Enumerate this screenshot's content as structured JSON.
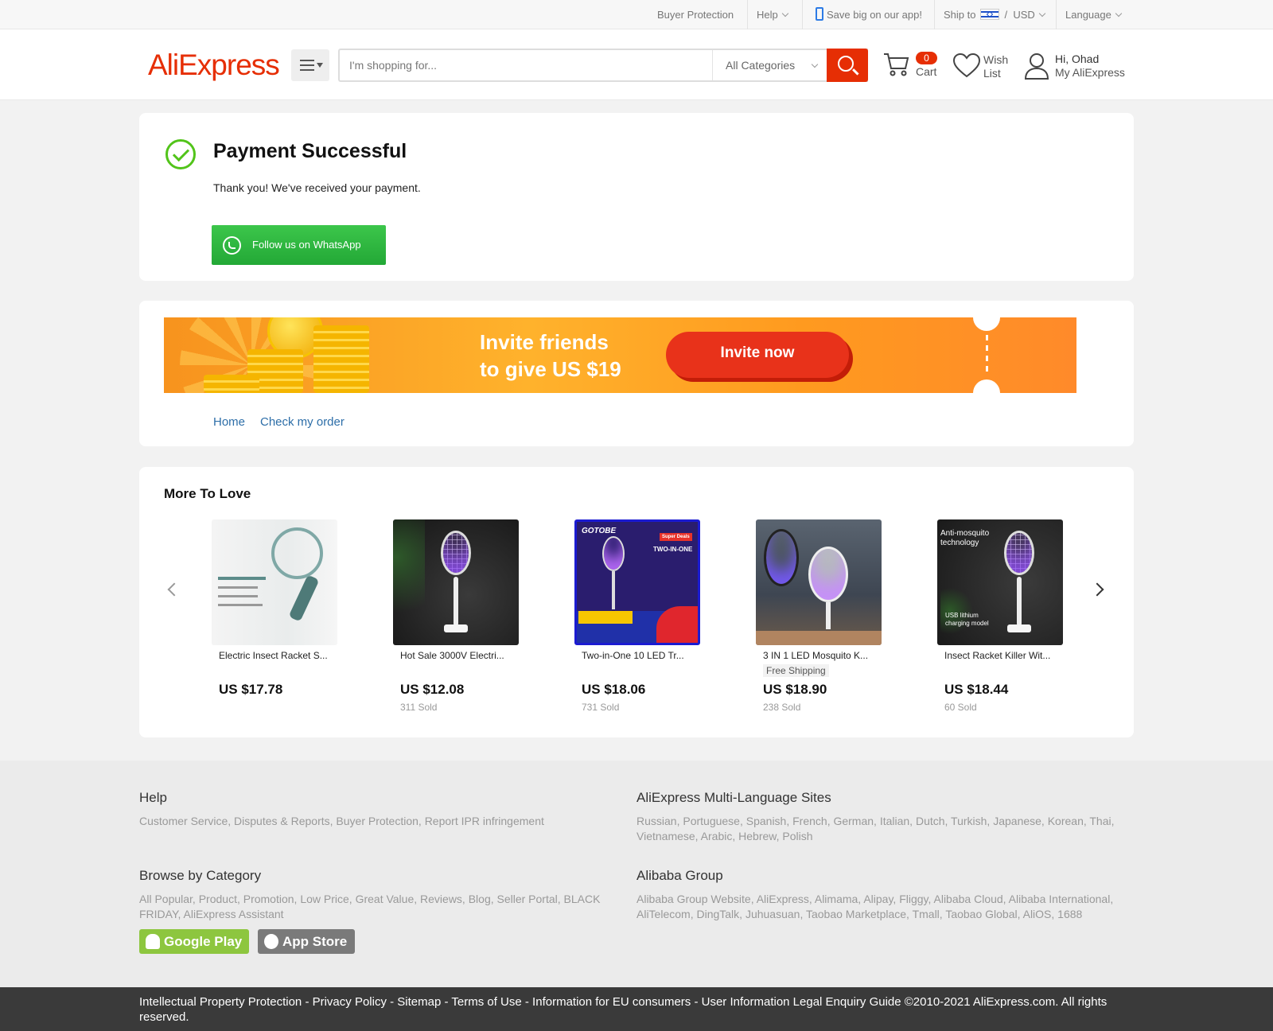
{
  "topbar": {
    "buyer_protection": "Buyer Protection",
    "help": "Help",
    "app": "Save big on our app!",
    "ship_to": "Ship to",
    "currency_sep": "/",
    "currency": "USD",
    "language": "Language"
  },
  "header": {
    "logo": "AliExpress",
    "search_placeholder": "I'm shopping for...",
    "category": "All Categories",
    "cart_count": "0",
    "cart_label": "Cart",
    "wish_label": "Wish List",
    "greeting": "Hi, Ohad",
    "account": "My AliExpress"
  },
  "payment": {
    "title": "Payment Successful",
    "message": "Thank you! We've received your payment.",
    "whatsapp_button": "Follow us on WhatsApp"
  },
  "banner": {
    "line1": "Invite friends",
    "line2": "to give US $19",
    "button": "Invite now"
  },
  "links": {
    "home": "Home",
    "check_order": "Check my order"
  },
  "more_to_love": {
    "title": "More To Love",
    "products": [
      {
        "name": "Electric Insect Racket S...",
        "price": "US $17.78",
        "sold": "",
        "shipping": ""
      },
      {
        "name": "Hot Sale 3000V Electri...",
        "price": "US $12.08",
        "sold": "311 Sold",
        "shipping": ""
      },
      {
        "name": "Two-in-One 10 LED Tr...",
        "price": "US $18.06",
        "sold": "731 Sold",
        "shipping": ""
      },
      {
        "name": "3 IN 1 LED Mosquito K...",
        "price": "US $18.90",
        "sold": "238 Sold",
        "shipping": "Free Shipping"
      },
      {
        "name": "Insect Racket Killer Wit...",
        "price": "US $18.44",
        "sold": "60 Sold",
        "shipping": ""
      }
    ],
    "image_text": {
      "gotobe": "GOTOBE",
      "super_deals": "Super Deals",
      "two_in_one": "TWO-IN-ONE",
      "anti_mosquito": "Anti-mosquito technology",
      "usb": "USB lithium charging model"
    }
  },
  "footer": {
    "help_title": "Help",
    "help_links": "Customer Service, Disputes & Reports, Buyer Protection, Report IPR infringement",
    "multi_title": "AliExpress Multi-Language Sites",
    "multi_links": "Russian, Portuguese, Spanish, French, German, Italian, Dutch, Turkish, Japanese, Korean, Thai, Vietnamese, Arabic, Hebrew, Polish",
    "browse_title": "Browse by Category",
    "browse_links": "All Popular, Product, Promotion, Low Price, Great Value, Reviews, Blog, Seller Portal, BLACK FRIDAY, AliExpress Assistant",
    "alibaba_title": "Alibaba Group",
    "alibaba_links": "Alibaba Group Website, AliExpress, Alimama, Alipay, Fliggy, Alibaba Cloud, Alibaba International, AliTelecom, DingTalk, Juhuasuan, Taobao Marketplace, Tmall, Taobao Global, AliOS, 1688",
    "google_play": "Google Play",
    "app_store": "App Store",
    "bottom": "Intellectual Property Protection - Privacy Policy - Sitemap - Terms of Use - Information for EU consumers - User Information Legal Enquiry Guide ©2010-2021 AliExpress.com. All rights reserved."
  },
  "colors": {
    "brand": "#e62e04",
    "success": "#52c41a",
    "whatsapp": "#2bb741",
    "link": "#2d6ea8"
  }
}
